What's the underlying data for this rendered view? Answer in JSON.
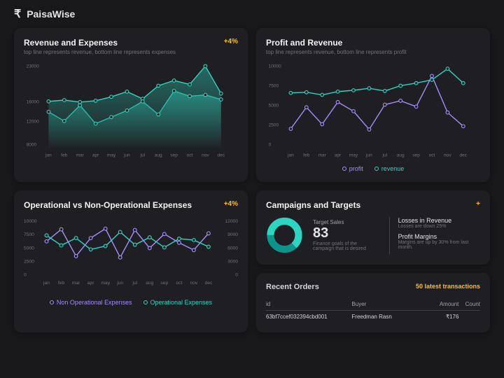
{
  "app": {
    "name": "PaisaWise"
  },
  "months": [
    "jan",
    "feb",
    "mar",
    "apr",
    "may",
    "jun",
    "jul",
    "aug",
    "sep",
    "oct",
    "nov",
    "dec"
  ],
  "card1": {
    "title": "Revenue and Expenses",
    "sub": "top line represents revenue, bottom line represents expenses",
    "pct": "+4%",
    "yticks": [
      "23000",
      "16000",
      "12000",
      "8000"
    ]
  },
  "card2": {
    "title": "Profit and Revenue",
    "sub": "top line represents revenue, bottom line represents profit",
    "yticks": [
      "10000",
      "7500",
      "5000",
      "2500",
      "0"
    ],
    "legend": {
      "a": "profit",
      "b": "revenue"
    }
  },
  "card3": {
    "title": "Operational vs Non-Operational Expenses",
    "pct": "+4%",
    "yl": [
      "10000",
      "7500",
      "5000",
      "2500",
      "0"
    ],
    "yr": [
      "12000",
      "9000",
      "6000",
      "3000",
      "0"
    ],
    "legend": {
      "a": "Non Operational Expenses",
      "b": "Operational Expenses"
    }
  },
  "card4": {
    "title": "Campaigns and Targets",
    "target": {
      "label": "Target Sales",
      "value": "83",
      "sub": "Finance goals of the campaign that is desired"
    },
    "right": [
      {
        "h": "Losses in Revenue",
        "s": "Losses are down 25%"
      },
      {
        "h": "Profit Margins",
        "s": "Margins are up by 30% from last month."
      }
    ]
  },
  "card5": {
    "title": "Recent Orders",
    "badge": "50 latest transactions",
    "cols": [
      "id",
      "Buyer",
      "Amount",
      "Count"
    ],
    "row0": {
      "id": "63bf7ccef032394cbd001",
      "buyer": "Freedman Rasn",
      "amt": "₹176",
      "cnt": ""
    }
  },
  "chart_data": [
    {
      "type": "area",
      "title": "Revenue and Expenses",
      "categories": [
        "jan",
        "feb",
        "mar",
        "apr",
        "may",
        "jun",
        "jul",
        "aug",
        "sep",
        "oct",
        "nov",
        "dec"
      ],
      "series": [
        {
          "name": "revenue",
          "values": [
            15800,
            16000,
            15600,
            15800,
            16500,
            17500,
            16200,
            18500,
            19500,
            18800,
            22500,
            17000
          ]
        },
        {
          "name": "expenses",
          "values": [
            14000,
            12200,
            15200,
            11800,
            13000,
            14200,
            15800,
            13500,
            17800,
            16800,
            17000,
            16200
          ]
        }
      ],
      "ylim": [
        8000,
        23000
      ]
    },
    {
      "type": "line",
      "title": "Profit and Revenue",
      "categories": [
        "jan",
        "feb",
        "mar",
        "apr",
        "may",
        "jun",
        "jul",
        "aug",
        "sep",
        "oct",
        "nov",
        "dec"
      ],
      "series": [
        {
          "name": "revenue",
          "values": [
            6600,
            6700,
            6400,
            6800,
            7000,
            7200,
            6900,
            7500,
            7800,
            8200,
            9600,
            7800
          ]
        },
        {
          "name": "profit",
          "values": [
            2100,
            4800,
            2600,
            5500,
            4300,
            2000,
            5200,
            5700,
            4900,
            8800,
            4200,
            2400
          ]
        }
      ],
      "ylim": [
        0,
        10000
      ]
    },
    {
      "type": "line",
      "title": "Operational vs Non-Operational Expenses",
      "categories": [
        "jan",
        "feb",
        "mar",
        "apr",
        "may",
        "jun",
        "jul",
        "aug",
        "sep",
        "oct",
        "nov",
        "dec"
      ],
      "series": [
        {
          "name": "Non Operational Expenses",
          "values": [
            6500,
            8800,
            3800,
            7200,
            9000,
            3500,
            8600,
            5200,
            7800,
            6200,
            4900,
            8000
          ]
        },
        {
          "name": "Operational Expenses",
          "values": [
            7600,
            5800,
            7100,
            5000,
            5600,
            8200,
            5900,
            7300,
            5400,
            7000,
            6800,
            5500
          ]
        }
      ],
      "ylim": [
        0,
        10000
      ]
    },
    {
      "type": "pie",
      "title": "Target Sales",
      "values": [
        83,
        17
      ]
    }
  ]
}
